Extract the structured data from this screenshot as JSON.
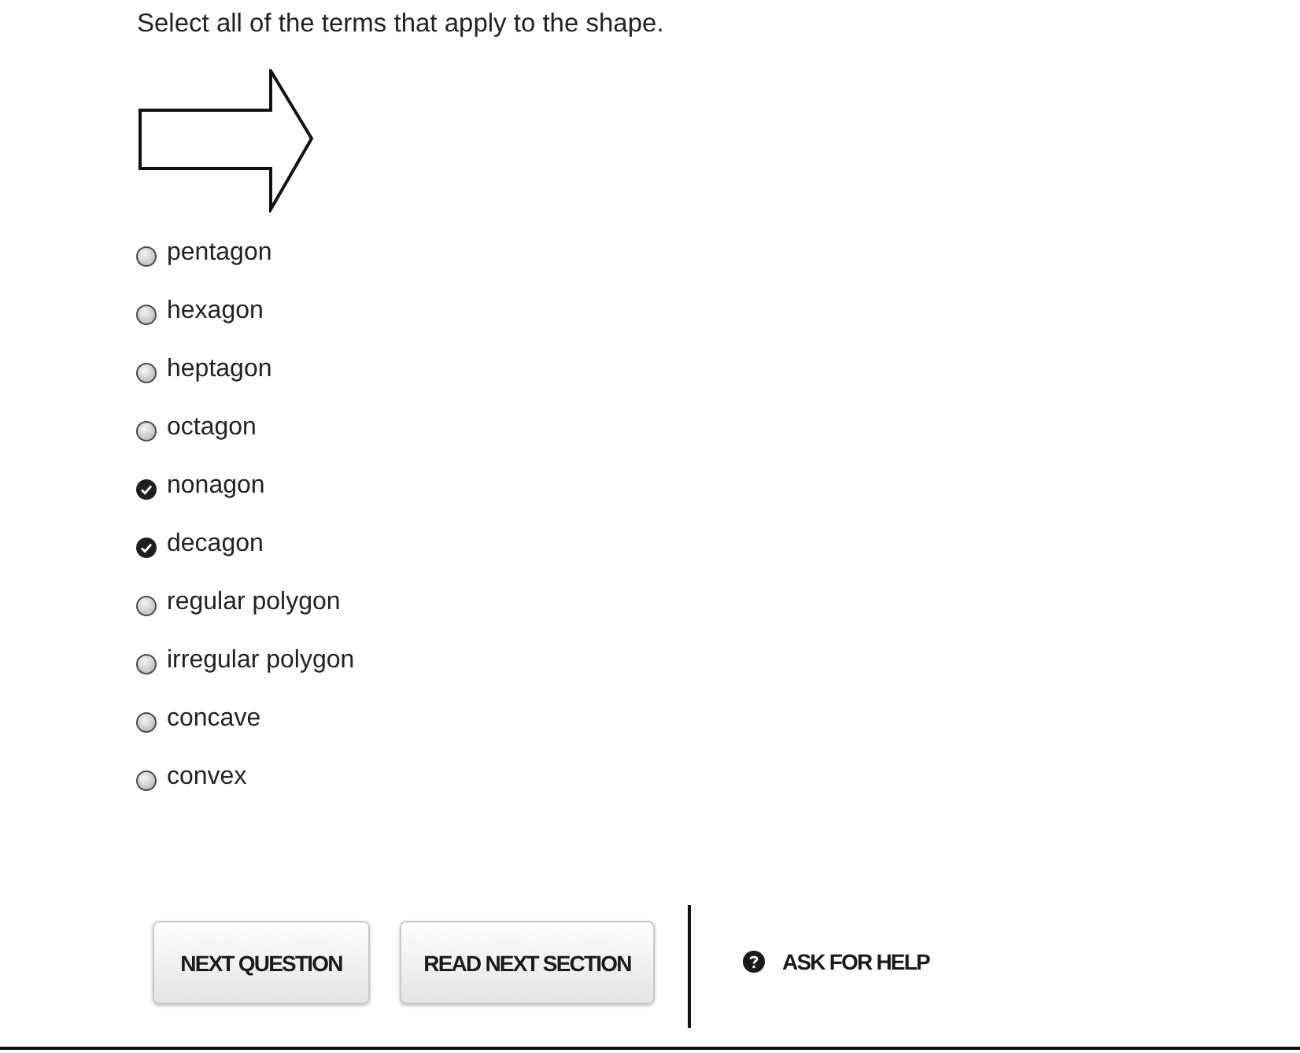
{
  "question": "Select all of the terms that apply to the shape.",
  "options": [
    {
      "label": "pentagon",
      "checked": false
    },
    {
      "label": "hexagon",
      "checked": false
    },
    {
      "label": "heptagon",
      "checked": false
    },
    {
      "label": "octagon",
      "checked": false
    },
    {
      "label": "nonagon",
      "checked": true
    },
    {
      "label": "decagon",
      "checked": true
    },
    {
      "label": "regular polygon",
      "checked": false
    },
    {
      "label": "irregular polygon",
      "checked": false
    },
    {
      "label": "concave",
      "checked": false
    },
    {
      "label": "convex",
      "checked": false
    }
  ],
  "buttons": [
    {
      "label": "NEXT QUESTION"
    },
    {
      "label": "READ NEXT SECTION"
    }
  ],
  "help": {
    "label": "ASK FOR HELP"
  }
}
